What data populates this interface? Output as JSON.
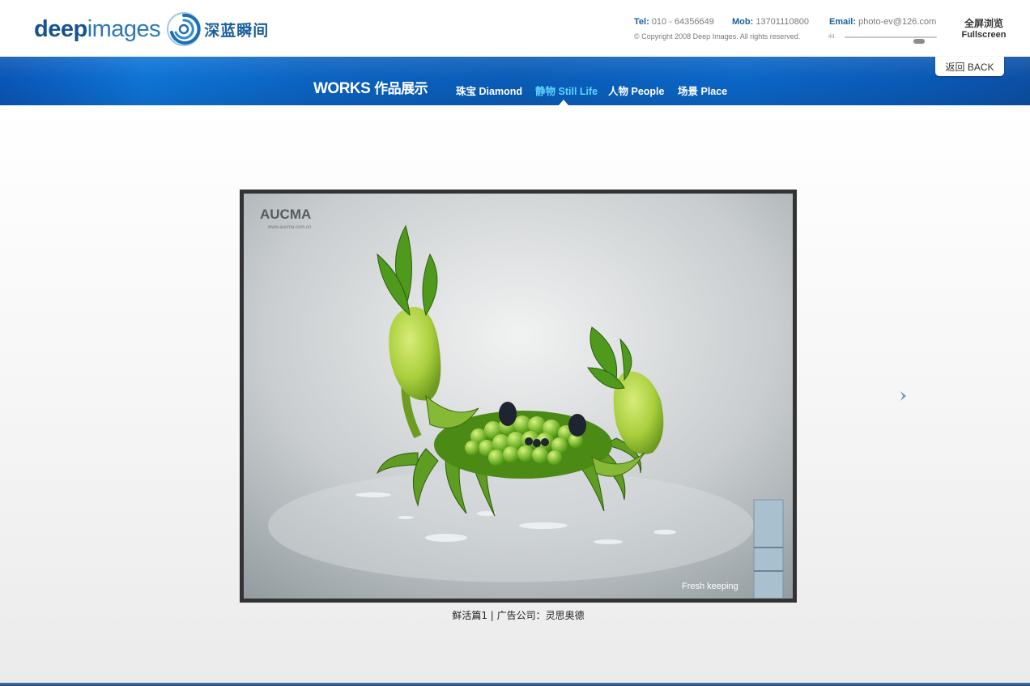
{
  "header": {
    "logo_word_bold": "deep",
    "logo_word_light": "images",
    "logo_cn": "深蓝瞬间",
    "tel_label": "Tel:",
    "tel_value": "010 - 64356649",
    "mob_label": "Mob:",
    "mob_value": "13701110800",
    "email_label": "Email:",
    "email_value": "photo-ev@126.com",
    "copyright": "© Copyright 2008 Deep Images. All rights reserved.",
    "volume_icon": "volume-icon",
    "volume_level": 0.85,
    "fullscreen_cn": "全屏浏览",
    "fullscreen_en": "Fullscreen"
  },
  "nav": {
    "section_en": "WORKS",
    "section_cn": "作品展示",
    "items": [
      {
        "cn": "珠宝",
        "en": "Diamond"
      },
      {
        "cn": "静物",
        "en": "Still Life"
      },
      {
        "cn": "人物",
        "en": "People"
      },
      {
        "cn": "场景",
        "en": "Place"
      }
    ],
    "active_index": 1,
    "back_cn": "返回",
    "back_en": "BACK"
  },
  "photo": {
    "brand": "AUCMA",
    "brand_url": "www.aucma.com.cn",
    "tagline": "Fresh keeping",
    "caption": "鲜活篇1 | 广告公司：灵思奥德"
  },
  "controls": {
    "next_icon": "chevron-right-icon"
  },
  "colors": {
    "brand_blue": "#1b5fa0",
    "nav_active": "#5fd4ff",
    "frame": "#333333"
  }
}
